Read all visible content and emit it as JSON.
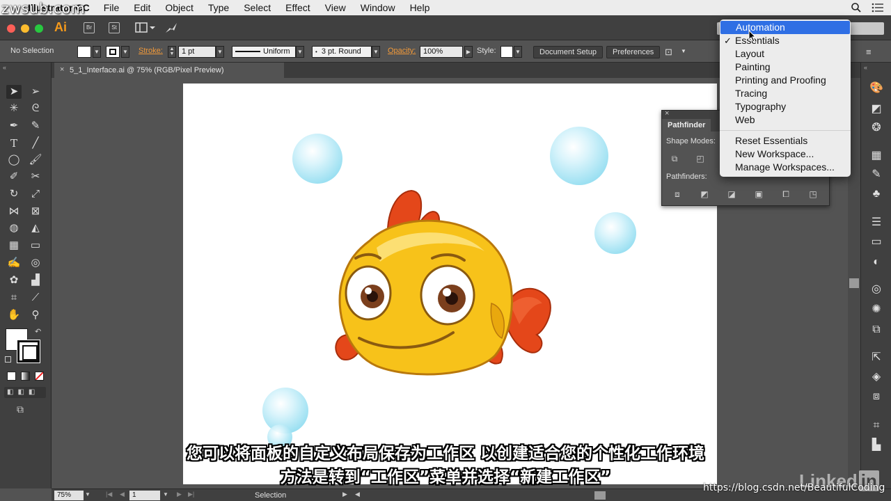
{
  "watermark_top": "zwsub.com",
  "menubar": {
    "app_name": "Illustrator CC",
    "items": [
      "File",
      "Edit",
      "Object",
      "Type",
      "Select",
      "Effect",
      "View",
      "Window",
      "Help"
    ]
  },
  "appbar": {
    "logo": "Ai",
    "bridge_label": "Br",
    "stock_label": "St"
  },
  "controlbar": {
    "selection_status": "No Selection",
    "stroke_label": "Stroke:",
    "stroke_weight": "1 pt",
    "stroke_profile": "Uniform",
    "brush": "3 pt. Round",
    "opacity_label": "Opacity:",
    "opacity_value": "100%",
    "style_label": "Style:",
    "document_setup": "Document Setup",
    "preferences": "Preferences"
  },
  "document_tab": {
    "close": "×",
    "title": "5_1_Interface.ai @ 75% (RGB/Pixel Preview)"
  },
  "pathfinder": {
    "close": "×",
    "tab": "Pathfinder",
    "shape_modes_label": "Shape Modes:",
    "pathfinders_label": "Pathfinders:"
  },
  "workspace_menu": {
    "items": [
      "Automation",
      "Essentials",
      "Layout",
      "Painting",
      "Printing and Proofing",
      "Tracing",
      "Typography",
      "Web"
    ],
    "checked": "Essentials",
    "highlighted": "Automation",
    "actions": [
      "Reset Essentials",
      "New Workspace...",
      "Manage Workspaces..."
    ]
  },
  "statusbar": {
    "zoom": "75%",
    "artboard": "1",
    "tool_name": "Selection"
  },
  "subtitles": {
    "line1": "您可以将面板的自定义布局保存为工作区 以创建适合您的个性化工作环境",
    "line2": "方法是转到“工作区”菜单并选择“新建工作区”"
  },
  "watermark_bottom": "https://blog.csdn.net/BeautifulCoding",
  "brand_watermark": "Linked",
  "colors": {
    "accent_orange": "#f29a3a",
    "highlight_blue": "#2f6fe4",
    "fish_yellow": "#f7c21a",
    "fish_fin_red": "#e4471a",
    "bubble_blue": "#8fdcf0"
  }
}
